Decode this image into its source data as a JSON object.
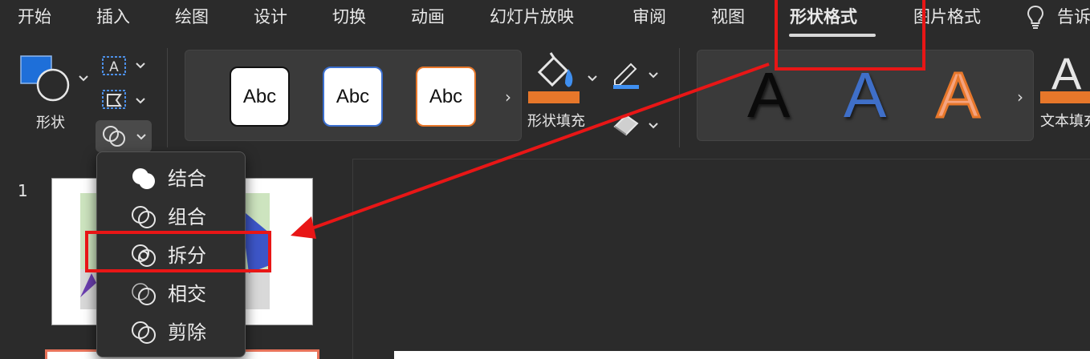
{
  "tabs": [
    {
      "label": "开始"
    },
    {
      "label": "插入"
    },
    {
      "label": "绘图"
    },
    {
      "label": "设计"
    },
    {
      "label": "切换"
    },
    {
      "label": "动画"
    },
    {
      "label": "幻灯片放映"
    },
    {
      "label": "审阅"
    },
    {
      "label": "视图"
    },
    {
      "label": "形状格式",
      "active": true
    },
    {
      "label": "图片格式"
    }
  ],
  "tell_me_label": "告诉",
  "ribbon": {
    "shapes_label": "形状",
    "shape_styles": [
      "Abc",
      "Abc",
      "Abc"
    ],
    "more_glyph": "›",
    "shape_fill_label": "形状填充",
    "wordart_styles": [
      "A",
      "A",
      "A"
    ],
    "text_fill_glyph": "A",
    "text_fill_label": "文本填充"
  },
  "merge_menu": {
    "items": [
      {
        "label": "结合",
        "icon": "union-icon"
      },
      {
        "label": "组合",
        "icon": "combine-icon"
      },
      {
        "label": "拆分",
        "icon": "fragment-icon"
      },
      {
        "label": "相交",
        "icon": "intersect-icon"
      },
      {
        "label": "剪除",
        "icon": "subtract-icon"
      }
    ]
  },
  "slides": {
    "number": "1"
  },
  "colors": {
    "accent_orange": "#e7772a",
    "accent_blue": "#3f6fc8",
    "annotation_red": "#e81616"
  }
}
